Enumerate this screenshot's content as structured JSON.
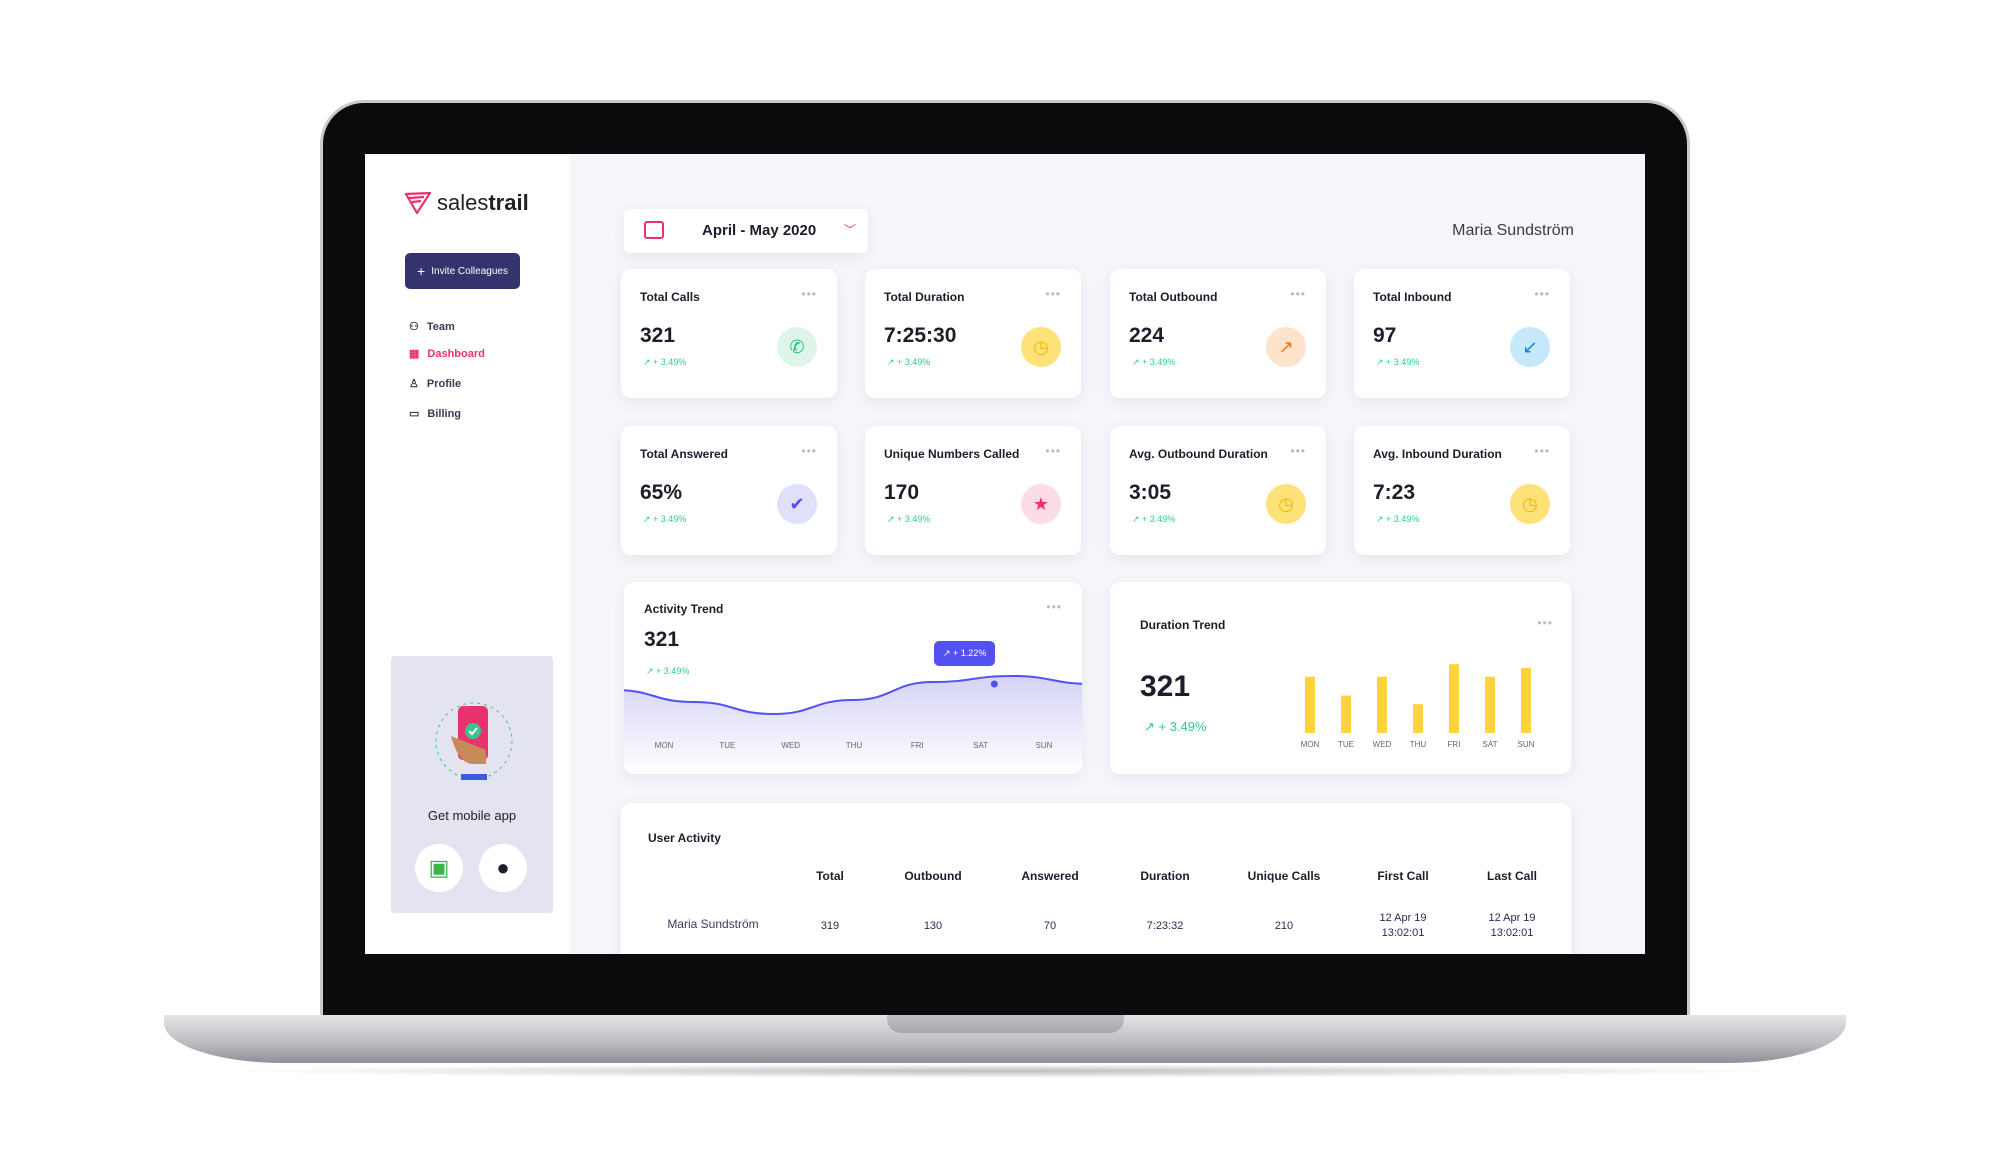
{
  "brand": {
    "name_light": "sales",
    "name_bold": "trail"
  },
  "sidebar": {
    "invite_label": "Invite Colleagues",
    "items": [
      {
        "label": "Team",
        "icon": "team-icon"
      },
      {
        "label": "Dashboard",
        "icon": "dashboard-icon",
        "active": true
      },
      {
        "label": "Profile",
        "icon": "profile-icon"
      },
      {
        "label": "Billing",
        "icon": "billing-icon"
      }
    ],
    "mobile": {
      "label": "Get mobile app",
      "stores": [
        "android-icon",
        "apple-icon"
      ]
    }
  },
  "header": {
    "date_range": "April - May 2020",
    "user": "Maria Sundström"
  },
  "stats": [
    {
      "label": "Total Calls",
      "value": "321",
      "change": "+ 3.49%",
      "icon": "phone-icon",
      "color": "#dff5ec",
      "fg": "#1fbf7a",
      "glyph": "✆"
    },
    {
      "label": "Total Duration",
      "value": "7:25:30",
      "change": "+ 3.49%",
      "icon": "clock-icon",
      "color": "#fde27a",
      "fg": "#f2b600",
      "glyph": "◷"
    },
    {
      "label": "Total Outbound",
      "value": "224",
      "change": "+ 3.49%",
      "icon": "outbound-call-icon",
      "color": "#fde2cc",
      "fg": "#f07a1a",
      "glyph": "↗"
    },
    {
      "label": "Total Inbound",
      "value": "97",
      "change": "+ 3.49%",
      "icon": "inbound-call-icon",
      "color": "#c6e8fb",
      "fg": "#1d7fd8",
      "glyph": "↙"
    },
    {
      "label": "Total Answered",
      "value": "65%",
      "change": "+ 3.49%",
      "icon": "check-icon",
      "color": "#e0e0fb",
      "fg": "#5b4be8",
      "glyph": "✔"
    },
    {
      "label": "Unique Numbers Called",
      "value": "170",
      "change": "+ 3.49%",
      "icon": "star-icon",
      "color": "#fcdde5",
      "fg": "#e8336e",
      "glyph": "★"
    },
    {
      "label": "Avg. Outbound Duration",
      "value": "3:05",
      "change": "+ 3.49%",
      "icon": "clock-icon",
      "color": "#fde27a",
      "fg": "#f2b600",
      "glyph": "◷"
    },
    {
      "label": "Avg. Inbound Duration",
      "value": "7:23",
      "change": "+ 3.49%",
      "icon": "clock-icon",
      "color": "#fde27a",
      "fg": "#f2b600",
      "glyph": "◷"
    }
  ],
  "activity": {
    "title": "Activity Trend",
    "value": "321",
    "change": "+ 3.49%",
    "tooltip": "+ 1.22%",
    "accent": "#5352f0"
  },
  "duration": {
    "title": "Duration Trend",
    "value": "321",
    "change": "+ 3.49%",
    "bar_color": "#fdd23c"
  },
  "chart_data": [
    {
      "type": "area",
      "title": "Activity Trend",
      "categories": [
        "MON",
        "TUE",
        "WED",
        "THU",
        "FRI",
        "SAT",
        "SUN"
      ],
      "values": [
        62,
        50,
        38,
        52,
        70,
        76,
        68
      ],
      "ylim": [
        0,
        100
      ],
      "grid": false
    },
    {
      "type": "bar",
      "title": "Duration Trend",
      "categories": [
        "MON",
        "TUE",
        "WED",
        "THU",
        "FRI",
        "SAT",
        "SUN"
      ],
      "values": [
        45,
        30,
        45,
        23,
        55,
        45,
        52
      ],
      "ylim": [
        0,
        60
      ],
      "grid": false
    }
  ],
  "table": {
    "title": "User Activity",
    "columns": [
      "Total",
      "Outbound",
      "Answered",
      "Duration",
      "Unique Calls",
      "First Call",
      "Last Call"
    ],
    "rows": [
      {
        "name": "Maria Sundström",
        "cells": [
          "319",
          "130",
          "70",
          "7:23:32",
          "210",
          "12 Apr 19 13:02:01",
          "12 Apr 19 13:02:01"
        ]
      }
    ]
  }
}
